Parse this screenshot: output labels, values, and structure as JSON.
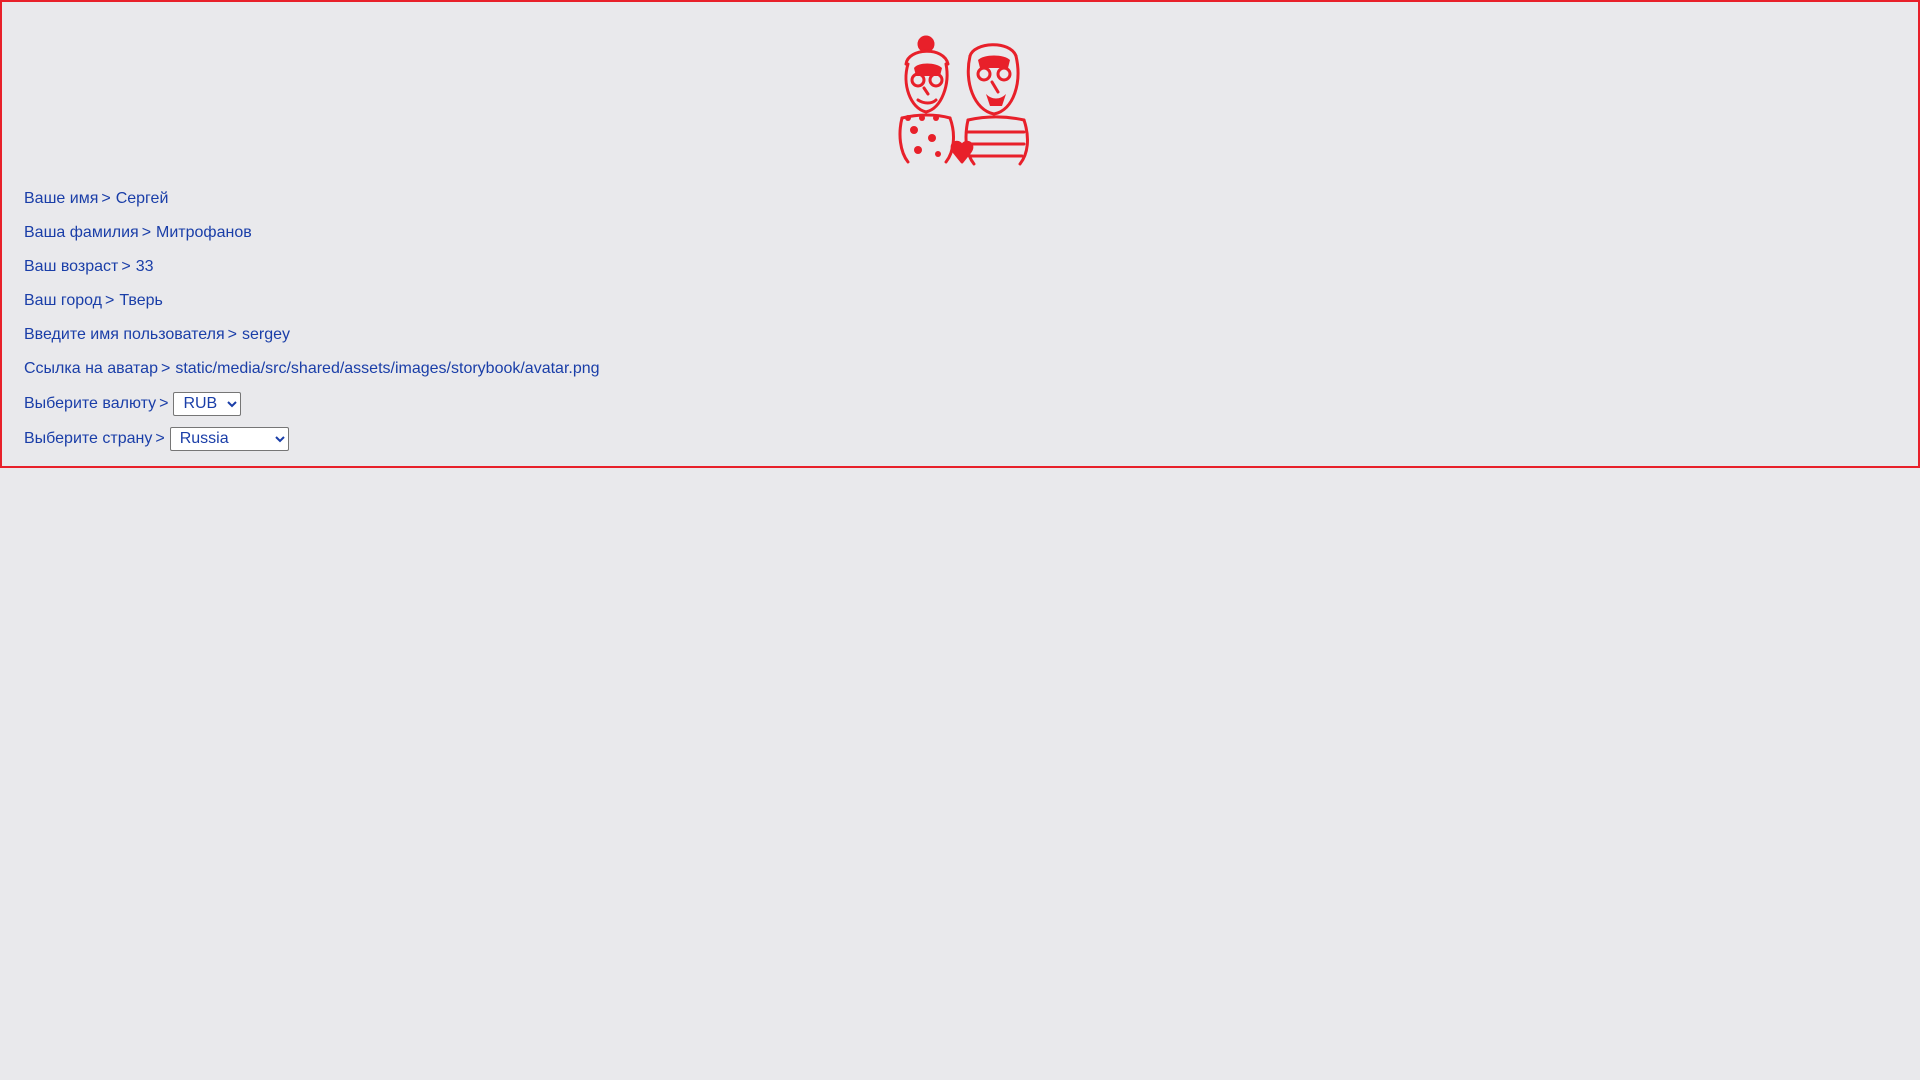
{
  "logo": {
    "icon": "couple-illustration-icon",
    "color": "#e8202a"
  },
  "fields": [
    {
      "label": "Ваше имя",
      "separator": ">",
      "value": "Сергей"
    },
    {
      "label": "Ваша фамилия",
      "separator": ">",
      "value": "Митрофанов"
    },
    {
      "label": "Ваш возраст",
      "separator": ">",
      "value": "33"
    },
    {
      "label": "Ваш город",
      "separator": ">",
      "value": "Тверь"
    },
    {
      "label": "Введите имя пользователя",
      "separator": ">",
      "value": "sergey"
    },
    {
      "label": "Ссылка на аватар",
      "separator": ">",
      "value": "static/media/src/shared/assets/images/storybook/avatar.png"
    }
  ],
  "currency": {
    "label": "Выберите валюту",
    "separator": ">",
    "selected": "RUB"
  },
  "country": {
    "label": "Выберите страну",
    "separator": ">",
    "selected": "Russia"
  },
  "colors": {
    "text": "#1a3ea8",
    "accent": "#e8202a",
    "background": "#e9e9ec"
  }
}
